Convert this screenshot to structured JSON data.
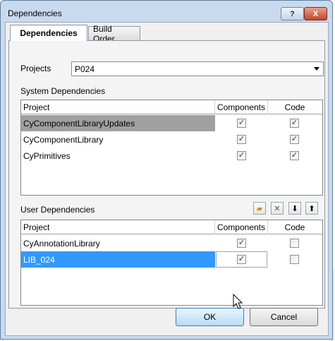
{
  "window": {
    "title": "Dependencies",
    "help_glyph": "?",
    "close_glyph": "X"
  },
  "tabs": [
    {
      "label": "Dependencies"
    },
    {
      "label": "Build Order"
    }
  ],
  "projects": {
    "label": "Projects",
    "selected": "P024"
  },
  "system_deps": {
    "label": "System Dependencies",
    "columns": [
      "Project",
      "Components",
      "Code"
    ],
    "rows": [
      {
        "project": "CyComponentLibraryUpdates",
        "components": true,
        "code": true
      },
      {
        "project": "CyComponentLibrary",
        "components": true,
        "code": true
      },
      {
        "project": "CyPrimitives",
        "components": true,
        "code": true
      }
    ]
  },
  "user_deps": {
    "label": "User Dependencies",
    "columns": [
      "Project",
      "Components",
      "Code"
    ],
    "rows": [
      {
        "project": "CyAnnotationLibrary",
        "components": true,
        "code": false
      },
      {
        "project": "LIB_024",
        "components": true,
        "code": false
      }
    ]
  },
  "toolbar": {
    "icons": [
      "folder-icon",
      "remove-icon",
      "move-down-icon",
      "move-up-icon"
    ]
  },
  "buttons": {
    "ok": "OK",
    "cancel": "Cancel"
  },
  "colors": {
    "selection": "#3399ff",
    "gray_selection": "#a0a0a0"
  }
}
